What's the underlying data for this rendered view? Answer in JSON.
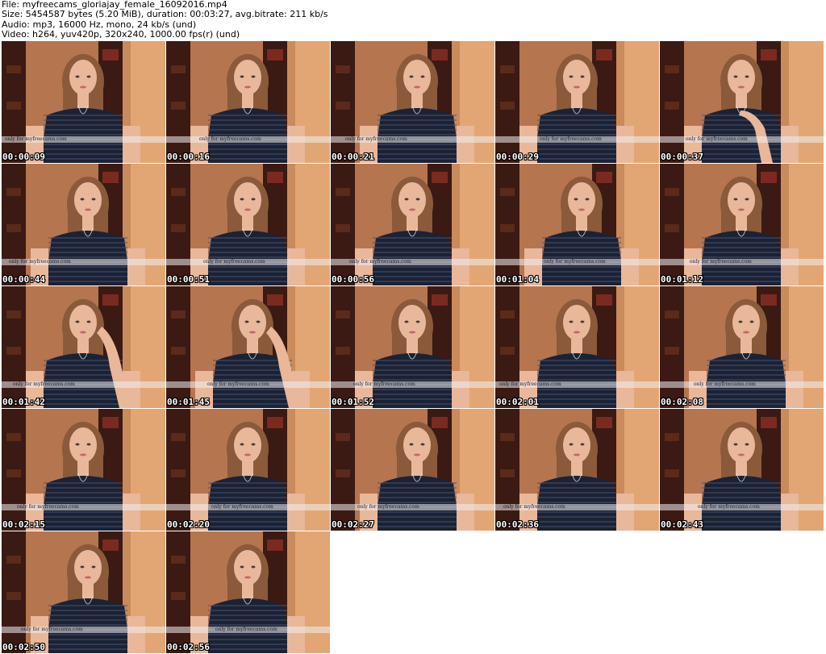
{
  "header": {
    "file": "File: myfreecams_gloriajay_female_16092016.mp4",
    "size": "Size: 5454587 bytes (5.20 MiB), duration: 00:03:27, avg.bitrate: 211 kb/s",
    "audio": "Audio: mp3, 16000 Hz, mono, 24 kb/s (und)",
    "video": "Video: h264, yuv420p, 320x240, 1000.00 fps(r) (und)"
  },
  "watermark_text": "only for myfreecams.com",
  "colors": {
    "wall": "#b5754f",
    "shelf": "#3a1a12",
    "door": "#e2a674",
    "shirt": "#1b2234",
    "skin": "#e9b79a",
    "hair": "#8a5a3a"
  },
  "thumbnails": [
    {
      "time": "00:00:09",
      "pose": "neutral"
    },
    {
      "time": "00:00:16",
      "pose": "neutral"
    },
    {
      "time": "00:00:21",
      "pose": "neutral"
    },
    {
      "time": "00:00:29",
      "pose": "neutral"
    },
    {
      "time": "00:00:37",
      "pose": "hand-chest"
    },
    {
      "time": "00:00:44",
      "pose": "neutral"
    },
    {
      "time": "00:00:51",
      "pose": "neutral"
    },
    {
      "time": "00:00:56",
      "pose": "neutral"
    },
    {
      "time": "00:01:04",
      "pose": "neutral"
    },
    {
      "time": "00:01:12",
      "pose": "neutral"
    },
    {
      "time": "00:01:42",
      "pose": "hand-face"
    },
    {
      "time": "00:01:45",
      "pose": "hand-face"
    },
    {
      "time": "00:01:52",
      "pose": "neutral"
    },
    {
      "time": "00:02:01",
      "pose": "neutral"
    },
    {
      "time": "00:02:08",
      "pose": "neutral"
    },
    {
      "time": "00:02:15",
      "pose": "neutral"
    },
    {
      "time": "00:02:20",
      "pose": "neutral"
    },
    {
      "time": "00:02:27",
      "pose": "neutral"
    },
    {
      "time": "00:02:36",
      "pose": "neutral"
    },
    {
      "time": "00:02:43",
      "pose": "neutral"
    },
    {
      "time": "00:02:50",
      "pose": "neutral"
    },
    {
      "time": "00:02:56",
      "pose": "neutral"
    }
  ]
}
